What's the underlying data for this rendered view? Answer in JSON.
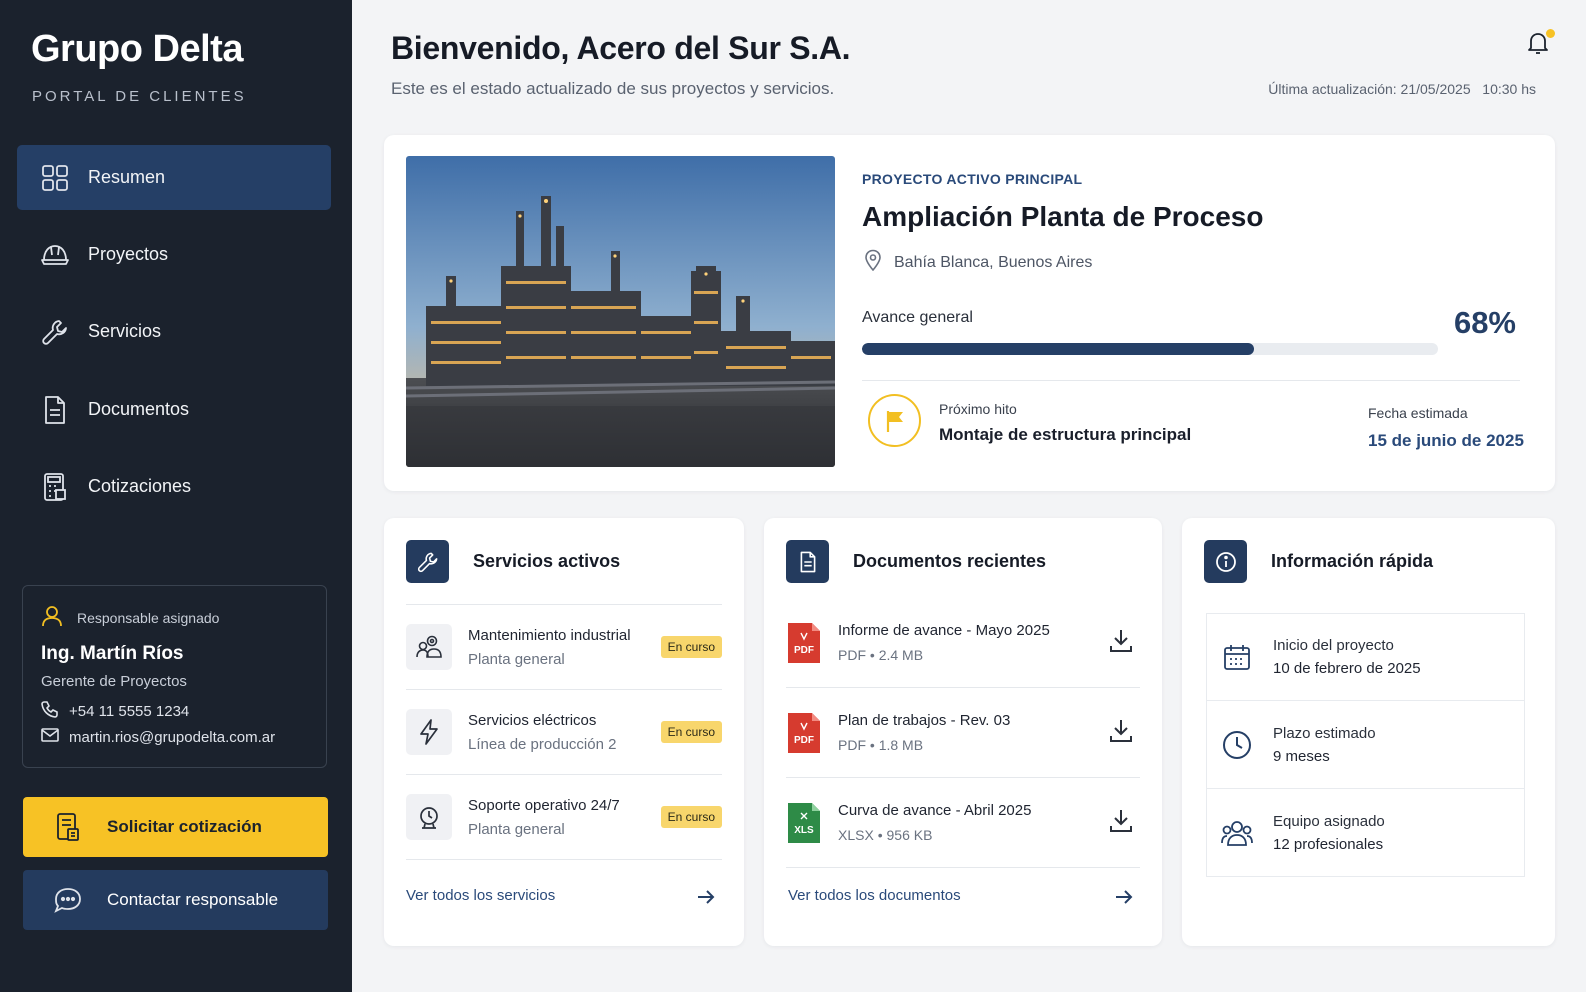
{
  "brand": {
    "name": "Grupo Delta",
    "subtitle": "PORTAL DE CLIENTES"
  },
  "nav": {
    "items": [
      {
        "label": "Resumen",
        "icon": "grid-icon",
        "active": true
      },
      {
        "label": "Proyectos",
        "icon": "helmet-icon",
        "active": false
      },
      {
        "label": "Servicios",
        "icon": "wrench-icon",
        "active": false
      },
      {
        "label": "Documentos",
        "icon": "document-icon",
        "active": false
      },
      {
        "label": "Cotizaciones",
        "icon": "calculator-icon",
        "active": false
      }
    ]
  },
  "responsible": {
    "heading": "Responsable asignado",
    "name": "Ing. Martín Ríos",
    "role": "Gerente de Proyectos",
    "phone": "+54 11 5555 1234",
    "email": "martin.rios@grupodelta.com.ar"
  },
  "actions": {
    "quote": "Solicitar cotización",
    "contact": "Contactar responsable"
  },
  "header": {
    "title": "Bienvenido, Acero del Sur S.A.",
    "subtitle": "Este es el estado actualizado de sus proyectos y servicios.",
    "updated": "Última actualización: 21/05/2025   10:30 hs"
  },
  "project": {
    "kicker": "PROYECTO ACTIVO PRINCIPAL",
    "title": "Ampliación Planta de Proceso",
    "location": "Bahía Blanca, Buenos Aires",
    "progress_label": "Avance general",
    "progress_value": 68,
    "progress_text": "68%",
    "milestone_label": "Próximo hito",
    "milestone": "Montaje de estructura principal",
    "date_label": "Fecha estimada",
    "date": "15 de junio de 2025"
  },
  "services": {
    "title": "Servicios activos",
    "items": [
      {
        "title": "Mantenimiento industrial",
        "sub": "Planta general",
        "status": "En curso",
        "icon": "team-gear-icon"
      },
      {
        "title": "Servicios eléctricos",
        "sub": "Línea de producción 2",
        "status": "En curso",
        "icon": "lightning-icon"
      },
      {
        "title": "Soporte operativo 24/7",
        "sub": "Planta general",
        "status": "En curso",
        "icon": "alarm-icon"
      }
    ],
    "link": "Ver todos los servicios"
  },
  "documents": {
    "title": "Documentos recientes",
    "items": [
      {
        "title": "Informe de avance - Mayo 2025",
        "type": "PDF",
        "size": "2.4 MB",
        "badge": "PDF",
        "color": "#d63b2f"
      },
      {
        "title": "Plan de trabajos - Rev. 03",
        "type": "PDF",
        "size": "1.8 MB",
        "badge": "PDF",
        "color": "#d63b2f"
      },
      {
        "title": "Curva de avance - Abril 2025",
        "type": "XLSX",
        "size": "956 KB",
        "badge": "XLS",
        "color": "#2e8b47"
      }
    ],
    "link": "Ver todos los documentos"
  },
  "info": {
    "title": "Información rápida",
    "items": [
      {
        "label": "Inicio del proyecto",
        "value": "10 de febrero de 2025",
        "icon": "calendar-icon"
      },
      {
        "label": "Plazo estimado",
        "value": "9 meses",
        "icon": "clock-icon"
      },
      {
        "label": "Equipo asignado",
        "value": "12 profesionales",
        "icon": "team-icon"
      }
    ]
  },
  "colors": {
    "sidebar": "#1b222d",
    "accent": "#253f66",
    "yellow": "#f7c225"
  }
}
